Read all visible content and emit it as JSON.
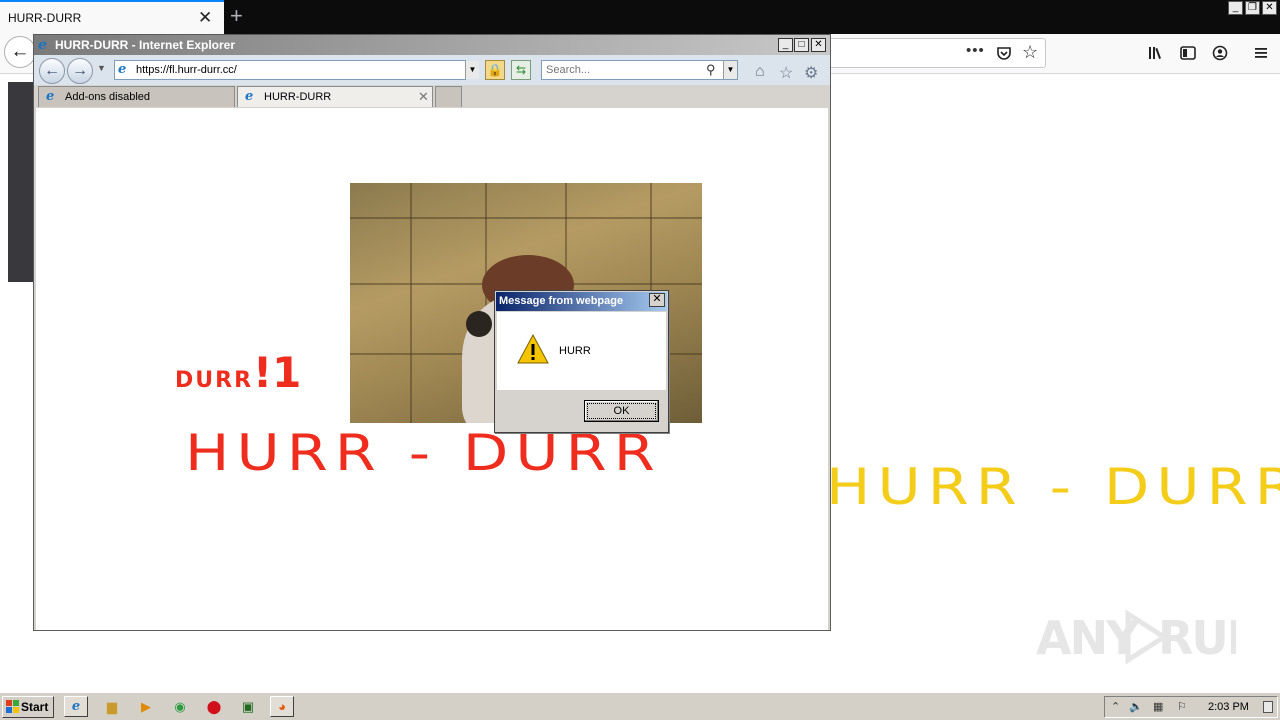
{
  "firefox": {
    "tab_title": "HURR-DURR",
    "tab_close": "✕",
    "new_tab": "+",
    "page_text": "HURR - DURR",
    "url_more": "•••",
    "accent": "#0a84ff",
    "text_color": "#f4cc1a"
  },
  "ie": {
    "window_title": "HURR-DURR - Internet Explorer",
    "address": "https://fl.hurr-durr.cc/",
    "search_placeholder": "Search...",
    "tabs": [
      {
        "label": "Add-ons disabled"
      },
      {
        "label": "HURR-DURR"
      }
    ],
    "tab_close": "✕",
    "page": {
      "small_text_lower": "DURR",
      "small_text_bang": "!1",
      "big_text": "HURR - DURR",
      "text_color": "#ef2d1e"
    }
  },
  "dialog": {
    "title": "Message from webpage",
    "message": "HURR",
    "ok_label": "OK",
    "close": "✕"
  },
  "taskbar": {
    "start_label": "Start",
    "clock": "2:03 PM"
  },
  "watermark": "ANY RUN"
}
